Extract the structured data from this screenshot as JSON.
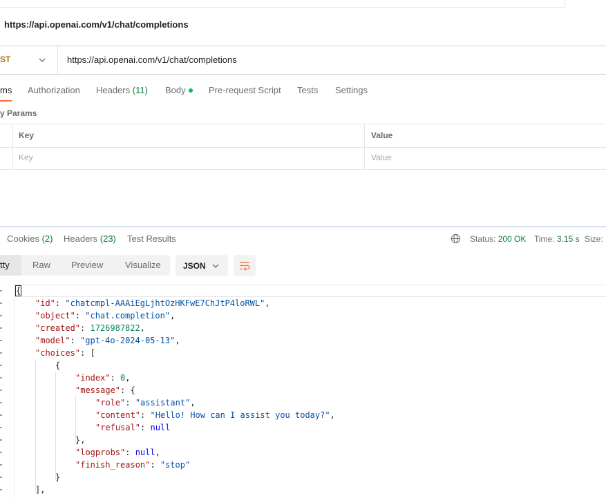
{
  "request": {
    "name": "https://api.openai.com/v1/chat/completions",
    "method": "ST",
    "url": "https://api.openai.com/v1/chat/completions"
  },
  "request_tabs": [
    {
      "label": "ms",
      "count": ""
    },
    {
      "label": "Authorization",
      "count": ""
    },
    {
      "label": "Headers",
      "count": "(11)"
    },
    {
      "label": "Body",
      "count": ""
    },
    {
      "label": "Pre-request Script",
      "count": ""
    },
    {
      "label": "Tests",
      "count": ""
    },
    {
      "label": "Settings",
      "count": ""
    }
  ],
  "params": {
    "title": "y Params",
    "header_key": "Key",
    "header_value": "Value",
    "placeholder_key": "Key",
    "placeholder_value": "Value"
  },
  "response_tabs": [
    {
      "label": "Cookies",
      "count": "(2)"
    },
    {
      "label": "Headers",
      "count": "(23)"
    },
    {
      "label": "Test Results",
      "count": ""
    }
  ],
  "status": {
    "status_label": "Status:",
    "status_value": "200 OK",
    "time_label": "Time:",
    "time_value": "3.15 s",
    "size_label": "Size:"
  },
  "view_options": [
    "tty",
    "Raw",
    "Preview",
    "Visualize"
  ],
  "format": "JSON",
  "response_body": {
    "id": "chatcmpl-AAAiEgLjhtOzHKFwE7ChJtP4loRWL",
    "object": "chat.completion",
    "created": "1726987822",
    "model": "gpt-4o-2024-05-13",
    "index": "0",
    "role": "assistant",
    "content": "Hello! How can I assist you today?",
    "refusal": "null",
    "logprobs": "null",
    "finish_reason": "stop"
  },
  "icons": {
    "globe": "globe-icon",
    "chevron": "chevron-down-icon",
    "wrap": "wrap-lines-icon"
  },
  "colors": {
    "accent": "#ff6c37",
    "success": "#0f7b3e",
    "method": "#ad7a03",
    "json_key": "#a31515",
    "json_string": "#0451a5",
    "json_number": "#098658",
    "json_keyword": "#0000ff"
  }
}
